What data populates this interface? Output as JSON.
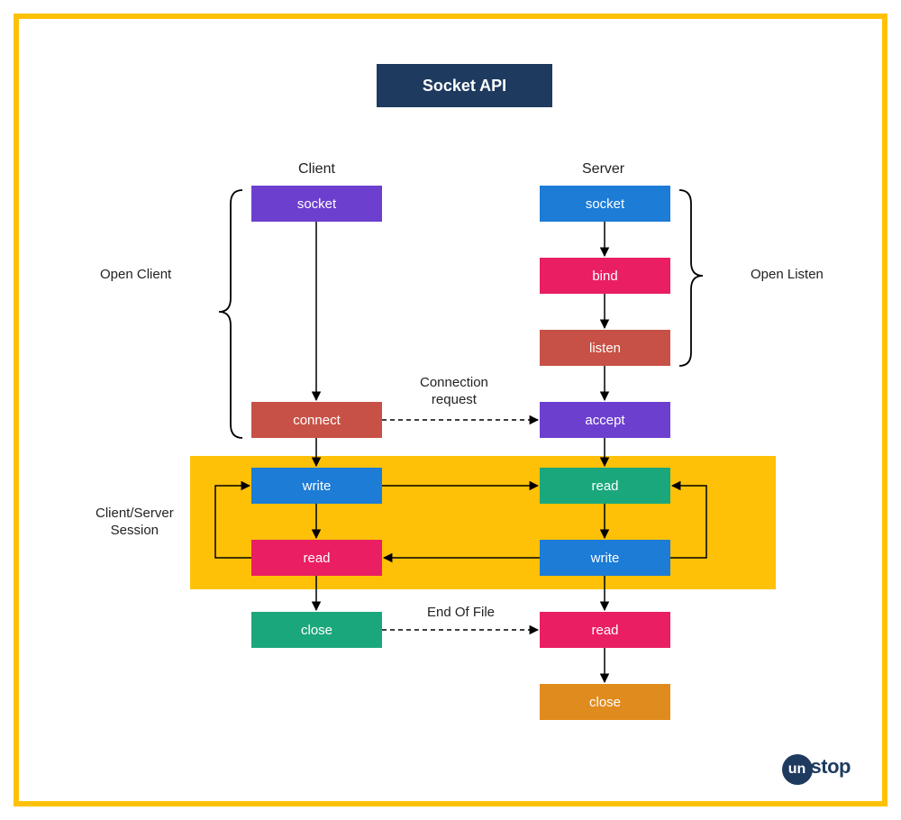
{
  "title": "Socket API",
  "columns": {
    "client": "Client",
    "server": "Server"
  },
  "client_nodes": {
    "socket": "socket",
    "connect": "connect",
    "write": "write",
    "read": "read",
    "close": "close"
  },
  "server_nodes": {
    "socket": "socket",
    "bind": "bind",
    "listen": "listen",
    "accept": "accept",
    "read1": "read",
    "write": "write",
    "read2": "read",
    "close": "close"
  },
  "annotations": {
    "open_client": "Open Client",
    "open_listen": "Open Listen",
    "conn_request": "Connection\nrequest",
    "session_label": "Client/Server\nSession",
    "eof": "End Of File"
  },
  "colors": {
    "frame": "#FFC107",
    "title": "#1E3A5F",
    "purple": "#6C3FCF",
    "blue": "#1C7CD6",
    "pink": "#E91E63",
    "red": "#C75146",
    "green": "#1BA77C",
    "orange": "#E08B1E"
  },
  "logo": {
    "circle": "un",
    "rest": "stop"
  }
}
